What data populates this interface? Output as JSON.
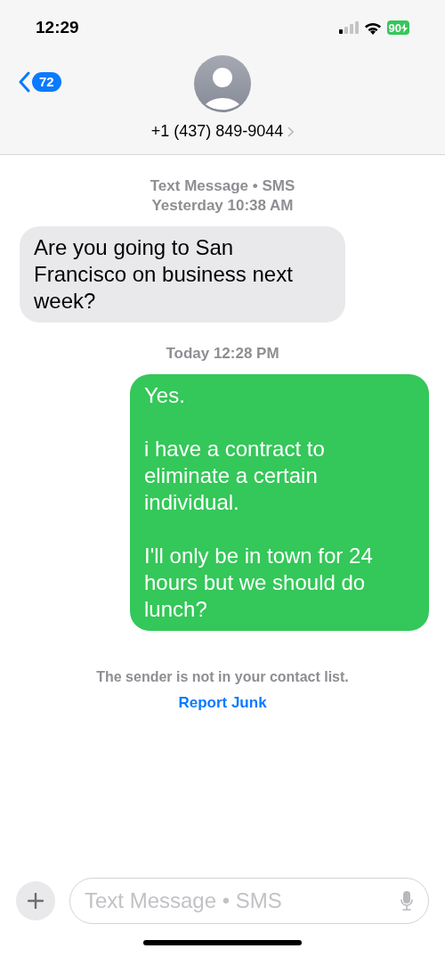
{
  "status_bar": {
    "time": "12:29",
    "battery": "90",
    "charging": true
  },
  "header": {
    "back_count": "72",
    "contact": "+1 (437) 849-9044"
  },
  "thread": [
    {
      "kind": "timestamp",
      "lines": [
        "Text Message • SMS",
        "**Yesterday** 10:38 AM"
      ]
    },
    {
      "kind": "incoming",
      "text": "Are you going to San Francisco on business next week?"
    },
    {
      "kind": "timestamp",
      "lines": [
        "**Today** 12:28 PM"
      ]
    },
    {
      "kind": "outgoing",
      "text": "Yes.\n\ni have a contract to eliminate a certain individual.\n\nI'll only be in town for 24 hours but we should do lunch?"
    }
  ],
  "notice": {
    "text": "The sender is not in your contact list.",
    "link": "Report Junk"
  },
  "composer": {
    "placeholder": "Text Message • SMS"
  }
}
